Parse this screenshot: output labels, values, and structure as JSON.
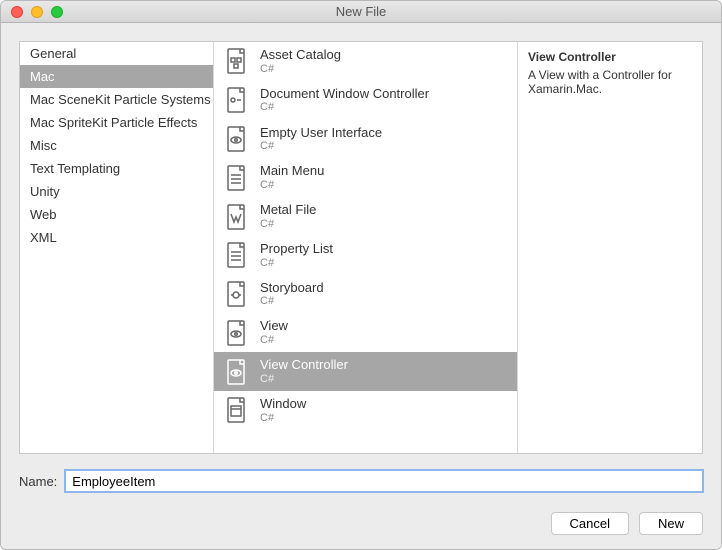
{
  "window_title": "New File",
  "categories": [
    "General",
    "Mac",
    "Mac SceneKit Particle Systems",
    "Mac SpriteKit Particle Effects",
    "Misc",
    "Text Templating",
    "Unity",
    "Web",
    "XML"
  ],
  "selected_category_index": 1,
  "templates": [
    {
      "name": "Asset Catalog",
      "sub": "C#",
      "icon": "asset"
    },
    {
      "name": "Document Window Controller",
      "sub": "C#",
      "icon": "doc"
    },
    {
      "name": "Empty User Interface",
      "sub": "C#",
      "icon": "eye"
    },
    {
      "name": "Main Menu",
      "sub": "C#",
      "icon": "list"
    },
    {
      "name": "Metal File",
      "sub": "C#",
      "icon": "metal"
    },
    {
      "name": "Property List",
      "sub": "C#",
      "icon": "list"
    },
    {
      "name": "Storyboard",
      "sub": "C#",
      "icon": "story"
    },
    {
      "name": "View",
      "sub": "C#",
      "icon": "eye"
    },
    {
      "name": "View Controller",
      "sub": "C#",
      "icon": "eye"
    },
    {
      "name": "Window",
      "sub": "C#",
      "icon": "window"
    }
  ],
  "selected_template_index": 8,
  "detail": {
    "title": "View Controller",
    "desc": "A View with a Controller for Xamarin.Mac."
  },
  "name_label": "Name:",
  "name_value": "EmployeeItem",
  "buttons": {
    "cancel": "Cancel",
    "new": "New"
  }
}
